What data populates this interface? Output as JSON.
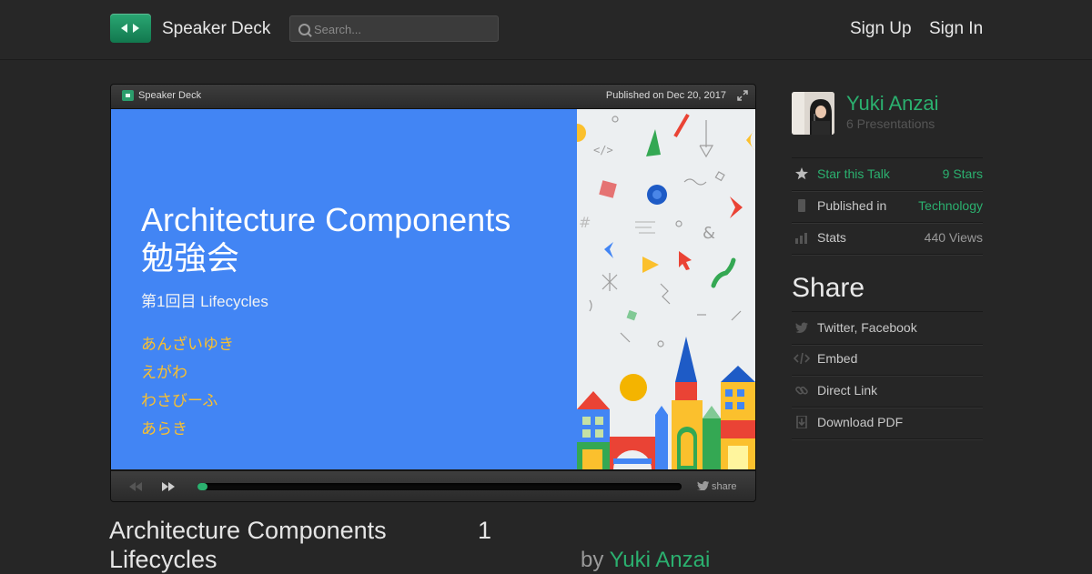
{
  "header": {
    "brand": "Speaker Deck",
    "search_placeholder": "Search...",
    "sign_up": "Sign Up",
    "sign_in": "Sign In"
  },
  "player": {
    "brand_label": "Speaker Deck",
    "published": "Published on Dec 20, 2017",
    "share_label": "share",
    "progress": 0.02,
    "slide": {
      "title_line1": "Architecture Components",
      "title_line2": "勉強会",
      "subtitle": "第1回目 Lifecycles",
      "names": [
        "あんざいゆき",
        "えがわ",
        "わさびーふ",
        "あらき"
      ]
    }
  },
  "talk": {
    "title_line1": "Architecture Components",
    "title_line2": "Lifecycles",
    "slide_number": "1",
    "by": "by",
    "author": "Yuki Anzai"
  },
  "sidebar": {
    "author_name": "Yuki Anzai",
    "presentations": "6 Presentations",
    "star_label": "Star this Talk",
    "stars": "9 Stars",
    "published_in_label": "Published in",
    "category": "Technology",
    "stats_label": "Stats",
    "views": "440 Views",
    "share_heading": "Share",
    "share_items": [
      "Twitter, Facebook",
      "Embed",
      "Direct Link",
      "Download PDF"
    ]
  },
  "colors": {
    "accent": "#2bb06f",
    "slide_blue": "#4285f4",
    "slide_yellow": "#fbc02d"
  },
  "icons": [
    "search-icon",
    "star-icon",
    "bookmark-icon",
    "stats-icon",
    "twitter-icon",
    "embed-icon",
    "link-icon",
    "download-icon",
    "prev-icon",
    "next-icon",
    "fullscreen-icon"
  ]
}
